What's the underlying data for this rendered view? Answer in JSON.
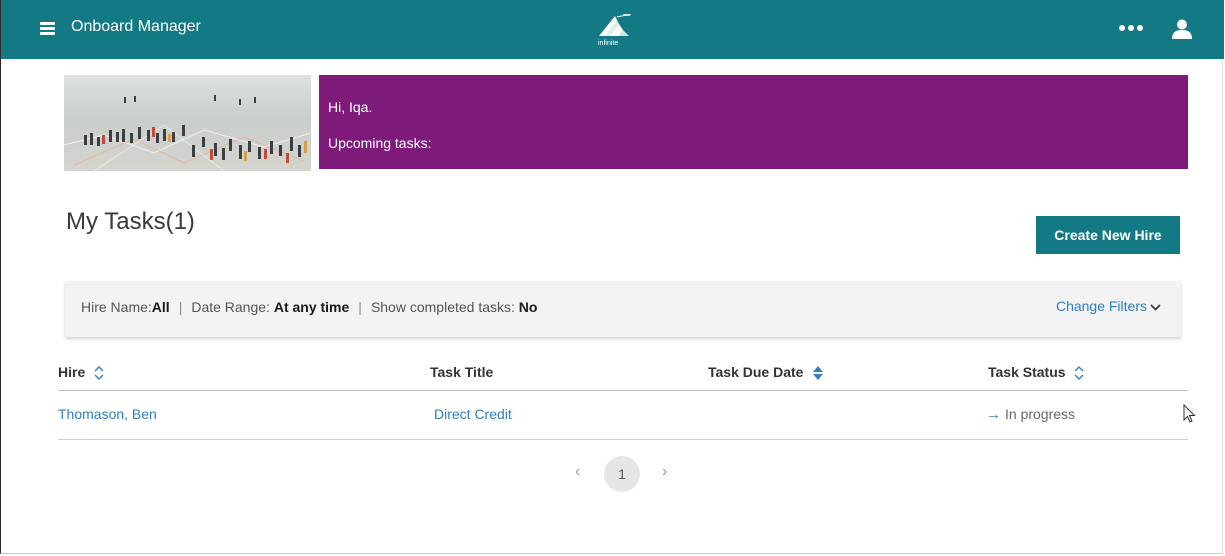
{
  "header": {
    "app_title": "Onboard Manager",
    "logo_text": "infinite"
  },
  "banner": {
    "greeting": "Hi, Iqa.",
    "upcoming_label": "Upcoming tasks:"
  },
  "page_title": "My Tasks(1)",
  "create_button_label": "Create New Hire",
  "filters": {
    "hire_name_label": "Hire Name:",
    "hire_name_value": "All",
    "separator": "|",
    "date_range_label": "Date Range: ",
    "date_range_value": "At any time",
    "completed_label": "Show completed tasks: ",
    "completed_value": "No",
    "change_filters_label": "Change Filters"
  },
  "table": {
    "columns": [
      "Hire",
      "Task Title",
      "Task Due Date",
      "Task Status"
    ],
    "rows": [
      {
        "hire": "Thomason, Ben",
        "task_title": "Direct Credit",
        "due_date": "",
        "status": "In progress"
      }
    ]
  },
  "pagination": {
    "prev": "‹",
    "current": "1",
    "next": "›"
  },
  "colors": {
    "topbar": "#137a85",
    "banner": "#7e1a7a",
    "link": "#2f7fc1"
  }
}
